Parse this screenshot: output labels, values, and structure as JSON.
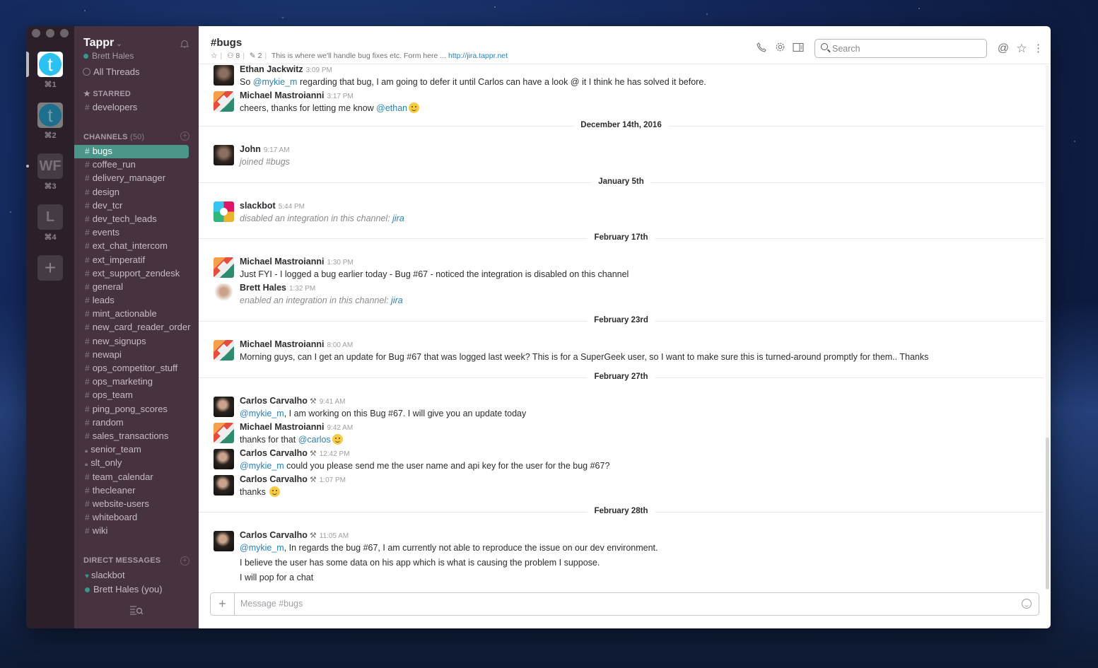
{
  "team_switcher": {
    "teams": [
      {
        "initial": "t",
        "shortcut": "⌘1"
      },
      {
        "initial": "t",
        "shortcut": "⌘2"
      },
      {
        "initial": "WF",
        "shortcut": "⌘3"
      },
      {
        "initial": "L",
        "shortcut": "⌘4"
      }
    ],
    "add_label": "+"
  },
  "sidebar": {
    "team_name": "Tappr",
    "team_chevron": "⌄",
    "user_name": "Brett Hales",
    "all_threads": "All Threads",
    "starred_label": "STARRED",
    "starred": [
      "developers"
    ],
    "channels_label": "CHANNELS",
    "channels_count": "(50)",
    "active_channel": "bugs",
    "channels": [
      {
        "name": "bugs",
        "private": false
      },
      {
        "name": "coffee_run",
        "private": false
      },
      {
        "name": "delivery_manager",
        "private": false
      },
      {
        "name": "design",
        "private": false
      },
      {
        "name": "dev_tcr",
        "private": false
      },
      {
        "name": "dev_tech_leads",
        "private": false
      },
      {
        "name": "events",
        "private": false
      },
      {
        "name": "ext_chat_intercom",
        "private": false
      },
      {
        "name": "ext_imperatif",
        "private": false
      },
      {
        "name": "ext_support_zendesk",
        "private": false
      },
      {
        "name": "general",
        "private": false
      },
      {
        "name": "leads",
        "private": false
      },
      {
        "name": "mint_actionable",
        "private": false
      },
      {
        "name": "new_card_reader_order",
        "private": false
      },
      {
        "name": "new_signups",
        "private": false
      },
      {
        "name": "newapi",
        "private": false
      },
      {
        "name": "ops_competitor_stuff",
        "private": false
      },
      {
        "name": "ops_marketing",
        "private": false
      },
      {
        "name": "ops_team",
        "private": false
      },
      {
        "name": "ping_pong_scores",
        "private": false
      },
      {
        "name": "random",
        "private": false
      },
      {
        "name": "sales_transactions",
        "private": false
      },
      {
        "name": "senior_team",
        "private": true
      },
      {
        "name": "slt_only",
        "private": true
      },
      {
        "name": "team_calendar",
        "private": false
      },
      {
        "name": "thecleaner",
        "private": false
      },
      {
        "name": "website-users",
        "private": false
      },
      {
        "name": "whiteboard",
        "private": false
      },
      {
        "name": "wiki",
        "private": false
      }
    ],
    "dm_label": "DIRECT MESSAGES",
    "dms": [
      {
        "name": "slackbot",
        "icon": "heart"
      },
      {
        "name": "Brett Hales (you)",
        "icon": "presence"
      }
    ]
  },
  "header": {
    "channel_title": "#bugs",
    "members_count": "8",
    "pinned_count": "2",
    "topic": "This is where we'll handle bug fixes etc. Form here ...",
    "topic_link": "http://jira.tappr.net",
    "search_placeholder": "Search"
  },
  "messages": [
    {
      "type": "msg",
      "author": "Ethan Jackwitz",
      "time": "3:09 PM",
      "avatar": "photo",
      "parts": [
        [
          "t",
          "So "
        ],
        [
          "m",
          "@mykie_m"
        ],
        [
          "t",
          " regarding that bug, I am going to defer it until Carlos can have a look @ it I think he has solved it before."
        ]
      ]
    },
    {
      "type": "msg",
      "author": "Michael Mastroianni",
      "time": "3:17 PM",
      "avatar": "mm",
      "parts": [
        [
          "t",
          "cheers, thanks for letting me know "
        ],
        [
          "m",
          "@ethan"
        ],
        [
          "e",
          ""
        ]
      ]
    },
    {
      "type": "day",
      "label": "December 14th, 2016"
    },
    {
      "type": "msg",
      "author": "John",
      "time": "9:17 AM",
      "avatar": "photo",
      "sys": true,
      "parts": [
        [
          "t",
          "joined #bugs"
        ]
      ]
    },
    {
      "type": "day",
      "label": "January 5th"
    },
    {
      "type": "msg",
      "author": "slackbot",
      "time": "5:44 PM",
      "avatar": "slack",
      "sys": true,
      "parts": [
        [
          "t",
          "disabled an integration in this channel: "
        ],
        [
          "m",
          "jira"
        ]
      ]
    },
    {
      "type": "day",
      "label": "February 17th"
    },
    {
      "type": "msg",
      "author": "Michael Mastroianni",
      "time": "1:30 PM",
      "avatar": "mm",
      "parts": [
        [
          "t",
          "Just FYI -  I logged a bug earlier today - Bug #67 - noticed the integration is disabled on this channel"
        ]
      ]
    },
    {
      "type": "msg",
      "author": "Brett Hales",
      "time": "1:32 PM",
      "avatar": "brett",
      "sys": true,
      "parts": [
        [
          "t",
          "enabled an integration in this channel: "
        ],
        [
          "m",
          "jira"
        ]
      ]
    },
    {
      "type": "day",
      "label": "February 23rd"
    },
    {
      "type": "msg",
      "author": "Michael Mastroianni",
      "time": "8:00 AM",
      "avatar": "mm",
      "parts": [
        [
          "t",
          "Morning guys, can I get an update for Bug #67 that was logged last week? This is for a SuperGeek user, so I want to make sure this is turned-around promptly for them.. Thanks"
        ]
      ]
    },
    {
      "type": "day",
      "label": "February 27th"
    },
    {
      "type": "msg",
      "author": "Carlos Carvalho",
      "tools": true,
      "time": "9:41 AM",
      "avatar": "carlos",
      "parts": [
        [
          "m",
          "@mykie_m"
        ],
        [
          "t",
          ", I am working on this Bug #67. I will give you an update today"
        ]
      ]
    },
    {
      "type": "msg",
      "author": "Michael Mastroianni",
      "time": "9:42 AM",
      "avatar": "mm",
      "parts": [
        [
          "t",
          "thanks for that "
        ],
        [
          "m",
          "@carlos"
        ],
        [
          "e",
          ""
        ]
      ]
    },
    {
      "type": "msg",
      "author": "Carlos Carvalho",
      "tools": true,
      "time": "12:42 PM",
      "avatar": "carlos",
      "parts": [
        [
          "m",
          "@mykie_m"
        ],
        [
          "t",
          " could you please send me the user name and api key for the user for the bug #67?"
        ]
      ]
    },
    {
      "type": "msg",
      "author": "Carlos Carvalho",
      "tools": true,
      "time": "1:07 PM",
      "avatar": "carlos",
      "parts": [
        [
          "t",
          "thanks "
        ],
        [
          "e",
          ""
        ]
      ]
    },
    {
      "type": "day",
      "label": "February 28th"
    },
    {
      "type": "msg",
      "author": "Carlos Carvalho",
      "tools": true,
      "time": "11:05 AM",
      "avatar": "carlos",
      "parts": [
        [
          "m",
          "@mykie_m"
        ],
        [
          "t",
          ", In regards the bug #67, I am currently not able to reproduce the issue on our dev environment."
        ]
      ],
      "extra": [
        "I believe the user has some data on his app which is what is causing the problem I suppose.",
        "I will pop for a chat"
      ]
    }
  ],
  "composer": {
    "placeholder": "Message #bugs",
    "add_label": "+"
  }
}
